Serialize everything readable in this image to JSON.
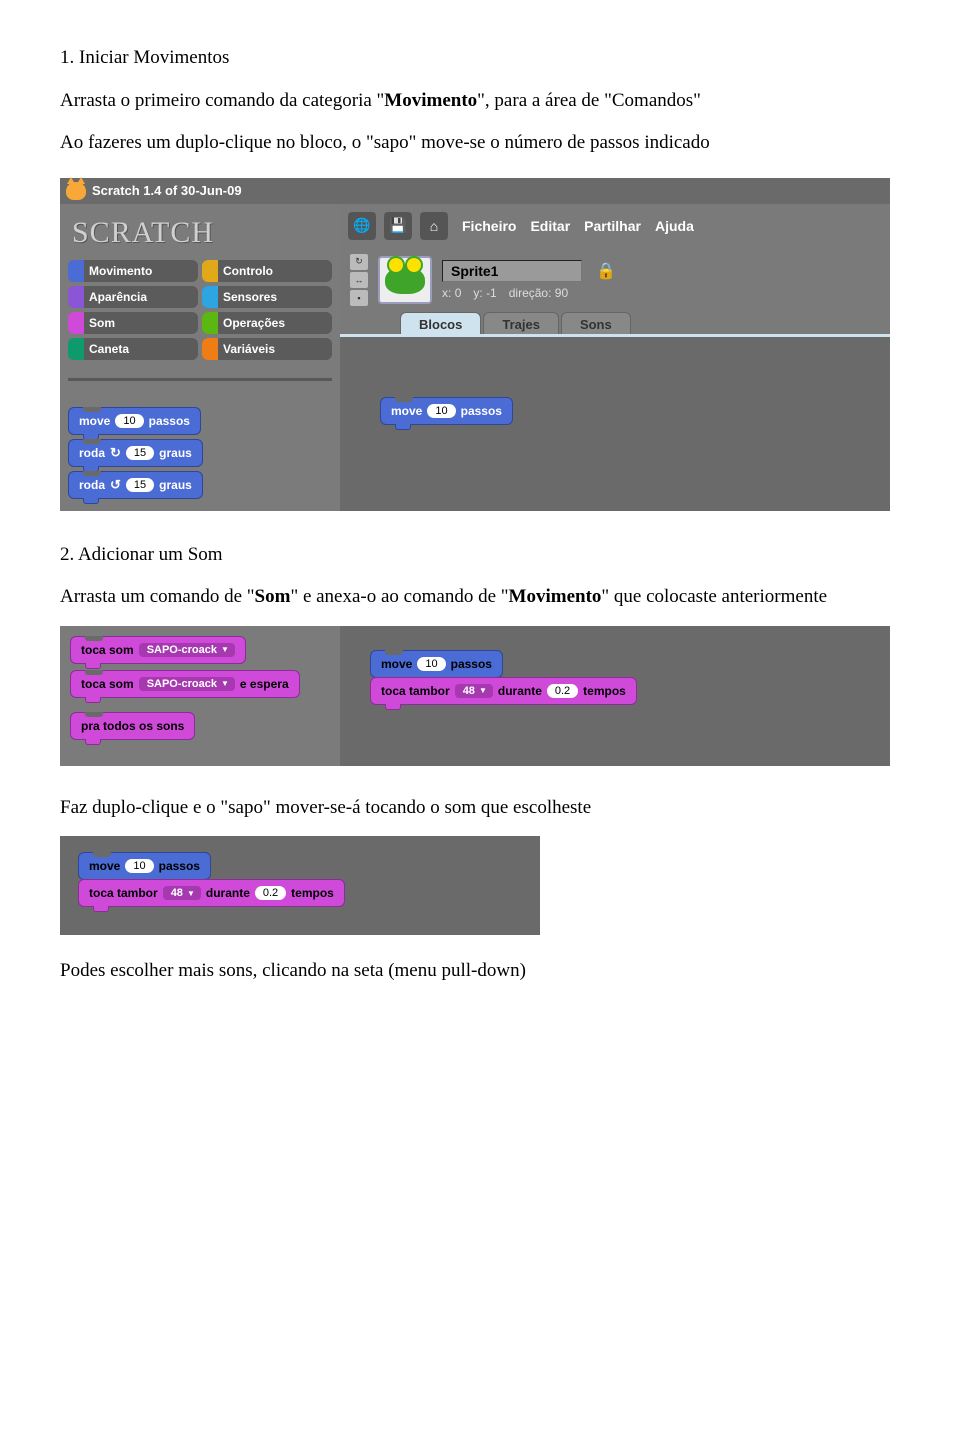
{
  "section1": {
    "heading": "1. Iniciar Movimentos",
    "p1_a": "Arrasta o primeiro comando da categoria \"",
    "p1_b": "Movimento",
    "p1_c": "\", para a área de \"Comandos\"",
    "p2": "Ao fazeres um duplo-clique no bloco, o \"sapo\" move-se o número de passos indicado"
  },
  "scratch": {
    "title": "Scratch 1.4 of 30-Jun-09",
    "logo": "SCRATCH",
    "menu": {
      "file": "Ficheiro",
      "edit": "Editar",
      "share": "Partilhar",
      "help": "Ajuda"
    },
    "categories": {
      "movimento": "Movimento",
      "controlo": "Controlo",
      "aparencia": "Aparência",
      "sensores": "Sensores",
      "som": "Som",
      "operacoes": "Operações",
      "caneta": "Caneta",
      "variaveis": "Variáveis"
    },
    "sprite": {
      "name": "Sprite1",
      "x_label": "x:",
      "x": "0",
      "y_label": "y:",
      "y": "-1",
      "dir_label": "direção:",
      "dir": "90"
    },
    "tabs": {
      "blocos": "Blocos",
      "trajes": "Trajes",
      "sons": "Sons"
    },
    "motion_blocks": {
      "move_label_a": "move",
      "move_steps": "10",
      "move_label_b": "passos",
      "roda_label": "roda",
      "roda_cw_deg": "15",
      "roda_ccw_deg": "15",
      "graus": "graus"
    },
    "script1": {
      "move_a": "move",
      "move_n": "10",
      "move_b": "passos"
    }
  },
  "section2": {
    "heading": "2. Adicionar um Som",
    "p1_a": "Arrasta um comando de \"",
    "p1_b": "Som",
    "p1_c": "\" e anexa-o ao comando de \"",
    "p1_d": "Movimento",
    "p1_e": "\" que colocaste anteriormente"
  },
  "panel2": {
    "left": {
      "b1_a": "toca som",
      "b1_dd": "SAPO-croack",
      "b2_a": "toca som",
      "b2_dd": "SAPO-croack",
      "b2_b": "e espera",
      "b3": "pra todos os sons"
    },
    "right": {
      "move_a": "move",
      "move_n": "10",
      "move_b": "passos",
      "tt_a": "toca tambor",
      "tt_dd": "48",
      "tt_b": "durante",
      "tt_n": "0.2",
      "tt_c": "tempos"
    }
  },
  "section3": {
    "p1": "Faz duplo-clique e o \"sapo\" mover-se-á tocando o som que escolheste"
  },
  "panel3": {
    "move_a": "move",
    "move_n": "10",
    "move_b": "passos",
    "tt_a": "toca tambor",
    "tt_dd": "48",
    "tt_b": "durante",
    "tt_n": "0.2",
    "tt_c": "tempos"
  },
  "section4": {
    "p1": "Podes escolher mais sons, clicando na seta (menu pull-down)"
  }
}
